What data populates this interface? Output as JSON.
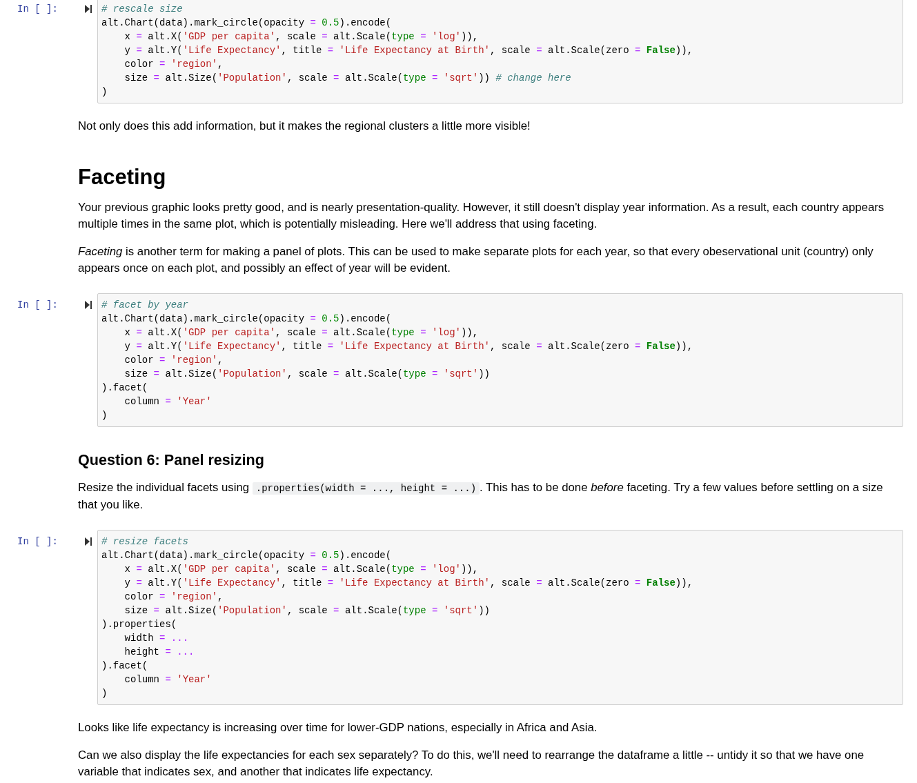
{
  "cells": [
    {
      "kind": "code",
      "prompt": "In [ ]:",
      "lines": [
        [
          {
            "kind": "comment",
            "text": "# rescale size"
          }
        ],
        [
          {
            "kind": "plain",
            "text": "alt.Chart(data).mark_circle(opacity"
          },
          {
            "kind": "operator",
            "text": " = "
          },
          {
            "kind": "number",
            "text": "0.5"
          },
          {
            "kind": "plain",
            "text": ").encode("
          }
        ],
        [
          {
            "kind": "plain",
            "text": "    x"
          },
          {
            "kind": "operator",
            "text": " = "
          },
          {
            "kind": "plain",
            "text": "alt.X("
          },
          {
            "kind": "string",
            "text": "'GDP per capita'"
          },
          {
            "kind": "plain",
            "text": ", scale"
          },
          {
            "kind": "operator",
            "text": " = "
          },
          {
            "kind": "plain",
            "text": "alt.Scale("
          },
          {
            "kind": "builtin",
            "text": "type"
          },
          {
            "kind": "operator",
            "text": " = "
          },
          {
            "kind": "string",
            "text": "'log'"
          },
          {
            "kind": "plain",
            "text": ")),"
          }
        ],
        [
          {
            "kind": "plain",
            "text": "    y"
          },
          {
            "kind": "operator",
            "text": " = "
          },
          {
            "kind": "plain",
            "text": "alt.Y("
          },
          {
            "kind": "string",
            "text": "'Life Expectancy'"
          },
          {
            "kind": "plain",
            "text": ", title"
          },
          {
            "kind": "operator",
            "text": " = "
          },
          {
            "kind": "string",
            "text": "'Life Expectancy at Birth'"
          },
          {
            "kind": "plain",
            "text": ", scale"
          },
          {
            "kind": "operator",
            "text": " = "
          },
          {
            "kind": "plain",
            "text": "alt.Scale(zero"
          },
          {
            "kind": "operator",
            "text": " = "
          },
          {
            "kind": "keyword",
            "text": "False"
          },
          {
            "kind": "plain",
            "text": ")),"
          }
        ],
        [
          {
            "kind": "plain",
            "text": "    color"
          },
          {
            "kind": "operator",
            "text": " = "
          },
          {
            "kind": "string",
            "text": "'region'"
          },
          {
            "kind": "plain",
            "text": ","
          }
        ],
        [
          {
            "kind": "plain",
            "text": "    size"
          },
          {
            "kind": "operator",
            "text": " = "
          },
          {
            "kind": "plain",
            "text": "alt.Size("
          },
          {
            "kind": "string",
            "text": "'Population'"
          },
          {
            "kind": "plain",
            "text": ", scale"
          },
          {
            "kind": "operator",
            "text": " = "
          },
          {
            "kind": "plain",
            "text": "alt.Scale("
          },
          {
            "kind": "builtin",
            "text": "type"
          },
          {
            "kind": "operator",
            "text": " = "
          },
          {
            "kind": "string",
            "text": "'sqrt'"
          },
          {
            "kind": "plain",
            "text": ")) "
          },
          {
            "kind": "comment",
            "text": "# change here"
          }
        ],
        [
          {
            "kind": "plain",
            "text": ")"
          }
        ]
      ]
    },
    {
      "kind": "paragraph",
      "segments": [
        {
          "kind": "prose",
          "text": "Not only does this add information, but it makes the regional clusters a little more visible!"
        }
      ]
    },
    {
      "kind": "heading",
      "text": "Faceting"
    },
    {
      "kind": "paragraph",
      "segments": [
        {
          "kind": "prose",
          "text": "Your previous graphic looks pretty good, and is nearly presentation-quality. However, it still doesn't display year information. As a result, each country appears multiple times in the same plot, which is potentially misleading. Here we'll address that using faceting."
        }
      ]
    },
    {
      "kind": "paragraph",
      "segments": [
        {
          "kind": "prose",
          "text": "*Faceting* is another term for making a panel of plots. This can be used to make separate plots for each year, so that every obeservational unit (country) only appears once on each plot, and possibly an effect of year will be evident."
        }
      ]
    },
    {
      "kind": "code",
      "prompt": "In [ ]:",
      "lines": [
        [
          {
            "kind": "comment",
            "text": "# facet by year"
          }
        ],
        [
          {
            "kind": "plain",
            "text": "alt.Chart(data).mark_circle(opacity"
          },
          {
            "kind": "operator",
            "text": " = "
          },
          {
            "kind": "number",
            "text": "0.5"
          },
          {
            "kind": "plain",
            "text": ").encode("
          }
        ],
        [
          {
            "kind": "plain",
            "text": "    x"
          },
          {
            "kind": "operator",
            "text": " = "
          },
          {
            "kind": "plain",
            "text": "alt.X("
          },
          {
            "kind": "string",
            "text": "'GDP per capita'"
          },
          {
            "kind": "plain",
            "text": ", scale"
          },
          {
            "kind": "operator",
            "text": " = "
          },
          {
            "kind": "plain",
            "text": "alt.Scale("
          },
          {
            "kind": "builtin",
            "text": "type"
          },
          {
            "kind": "operator",
            "text": " = "
          },
          {
            "kind": "string",
            "text": "'log'"
          },
          {
            "kind": "plain",
            "text": ")),"
          }
        ],
        [
          {
            "kind": "plain",
            "text": "    y"
          },
          {
            "kind": "operator",
            "text": " = "
          },
          {
            "kind": "plain",
            "text": "alt.Y("
          },
          {
            "kind": "string",
            "text": "'Life Expectancy'"
          },
          {
            "kind": "plain",
            "text": ", title"
          },
          {
            "kind": "operator",
            "text": " = "
          },
          {
            "kind": "string",
            "text": "'Life Expectancy at Birth'"
          },
          {
            "kind": "plain",
            "text": ", scale"
          },
          {
            "kind": "operator",
            "text": " = "
          },
          {
            "kind": "plain",
            "text": "alt.Scale(zero"
          },
          {
            "kind": "operator",
            "text": " = "
          },
          {
            "kind": "keyword",
            "text": "False"
          },
          {
            "kind": "plain",
            "text": ")),"
          }
        ],
        [
          {
            "kind": "plain",
            "text": "    color"
          },
          {
            "kind": "operator",
            "text": " = "
          },
          {
            "kind": "string",
            "text": "'region'"
          },
          {
            "kind": "plain",
            "text": ","
          }
        ],
        [
          {
            "kind": "plain",
            "text": "    size"
          },
          {
            "kind": "operator",
            "text": " = "
          },
          {
            "kind": "plain",
            "text": "alt.Size("
          },
          {
            "kind": "string",
            "text": "'Population'"
          },
          {
            "kind": "plain",
            "text": ", scale"
          },
          {
            "kind": "operator",
            "text": " = "
          },
          {
            "kind": "plain",
            "text": "alt.Scale("
          },
          {
            "kind": "builtin",
            "text": "type"
          },
          {
            "kind": "operator",
            "text": " = "
          },
          {
            "kind": "string",
            "text": "'sqrt'"
          },
          {
            "kind": "plain",
            "text": "))"
          }
        ],
        [
          {
            "kind": "plain",
            "text": ").facet("
          }
        ],
        [
          {
            "kind": "plain",
            "text": "    column"
          },
          {
            "kind": "operator",
            "text": " = "
          },
          {
            "kind": "string",
            "text": "'Year'"
          }
        ],
        [
          {
            "kind": "plain",
            "text": ")"
          }
        ]
      ]
    },
    {
      "kind": "subheading",
      "text": "Question 6: Panel resizing"
    },
    {
      "kind": "paragraph",
      "segments": [
        {
          "kind": "prose",
          "text": "Resize the individual facets using "
        },
        {
          "kind": "code",
          "text": ".properties(width = ..., height = ...)"
        },
        {
          "kind": "prose",
          "text": ". This has to be done *before* faceting. Try a few values before settling on a size that you like."
        }
      ]
    },
    {
      "kind": "code",
      "prompt": "In [ ]:",
      "lines": [
        [
          {
            "kind": "comment",
            "text": "# resize facets"
          }
        ],
        [
          {
            "kind": "plain",
            "text": "alt.Chart(data).mark_circle(opacity"
          },
          {
            "kind": "operator",
            "text": " = "
          },
          {
            "kind": "number",
            "text": "0.5"
          },
          {
            "kind": "plain",
            "text": ").encode("
          }
        ],
        [
          {
            "kind": "plain",
            "text": "    x"
          },
          {
            "kind": "operator",
            "text": " = "
          },
          {
            "kind": "plain",
            "text": "alt.X("
          },
          {
            "kind": "string",
            "text": "'GDP per capita'"
          },
          {
            "kind": "plain",
            "text": ", scale"
          },
          {
            "kind": "operator",
            "text": " = "
          },
          {
            "kind": "plain",
            "text": "alt.Scale("
          },
          {
            "kind": "builtin",
            "text": "type"
          },
          {
            "kind": "operator",
            "text": " = "
          },
          {
            "kind": "string",
            "text": "'log'"
          },
          {
            "kind": "plain",
            "text": ")),"
          }
        ],
        [
          {
            "kind": "plain",
            "text": "    y"
          },
          {
            "kind": "operator",
            "text": " = "
          },
          {
            "kind": "plain",
            "text": "alt.Y("
          },
          {
            "kind": "string",
            "text": "'Life Expectancy'"
          },
          {
            "kind": "plain",
            "text": ", title"
          },
          {
            "kind": "operator",
            "text": " = "
          },
          {
            "kind": "string",
            "text": "'Life Expectancy at Birth'"
          },
          {
            "kind": "plain",
            "text": ", scale"
          },
          {
            "kind": "operator",
            "text": " = "
          },
          {
            "kind": "plain",
            "text": "alt.Scale(zero"
          },
          {
            "kind": "operator",
            "text": " = "
          },
          {
            "kind": "keyword",
            "text": "False"
          },
          {
            "kind": "plain",
            "text": ")),"
          }
        ],
        [
          {
            "kind": "plain",
            "text": "    color"
          },
          {
            "kind": "operator",
            "text": " = "
          },
          {
            "kind": "string",
            "text": "'region'"
          },
          {
            "kind": "plain",
            "text": ","
          }
        ],
        [
          {
            "kind": "plain",
            "text": "    size"
          },
          {
            "kind": "operator",
            "text": " = "
          },
          {
            "kind": "plain",
            "text": "alt.Size("
          },
          {
            "kind": "string",
            "text": "'Population'"
          },
          {
            "kind": "plain",
            "text": ", scale"
          },
          {
            "kind": "operator",
            "text": " = "
          },
          {
            "kind": "plain",
            "text": "alt.Scale("
          },
          {
            "kind": "builtin",
            "text": "type"
          },
          {
            "kind": "operator",
            "text": " = "
          },
          {
            "kind": "string",
            "text": "'sqrt'"
          },
          {
            "kind": "plain",
            "text": "))"
          }
        ],
        [
          {
            "kind": "plain",
            "text": ").properties("
          }
        ],
        [
          {
            "kind": "plain",
            "text": "    width"
          },
          {
            "kind": "operator",
            "text": " = ..."
          }
        ],
        [
          {
            "kind": "plain",
            "text": "    height"
          },
          {
            "kind": "operator",
            "text": " = ..."
          }
        ],
        [
          {
            "kind": "plain",
            "text": ").facet("
          }
        ],
        [
          {
            "kind": "plain",
            "text": "    column"
          },
          {
            "kind": "operator",
            "text": " = "
          },
          {
            "kind": "string",
            "text": "'Year'"
          }
        ],
        [
          {
            "kind": "plain",
            "text": ")"
          }
        ]
      ]
    },
    {
      "kind": "paragraph",
      "segments": [
        {
          "kind": "prose",
          "text": "Looks like life expectancy is increasing over time for lower-GDP nations, especially in Africa and Asia."
        }
      ]
    },
    {
      "kind": "paragraph",
      "segments": [
        {
          "kind": "prose",
          "text": "Can we also display the life expectancies for each sex separately? To do this, we'll need to rearrange the dataframe a little -- untidy it so that we have one variable that indicates sex, and another that indicates life expectancy."
        }
      ]
    }
  ]
}
